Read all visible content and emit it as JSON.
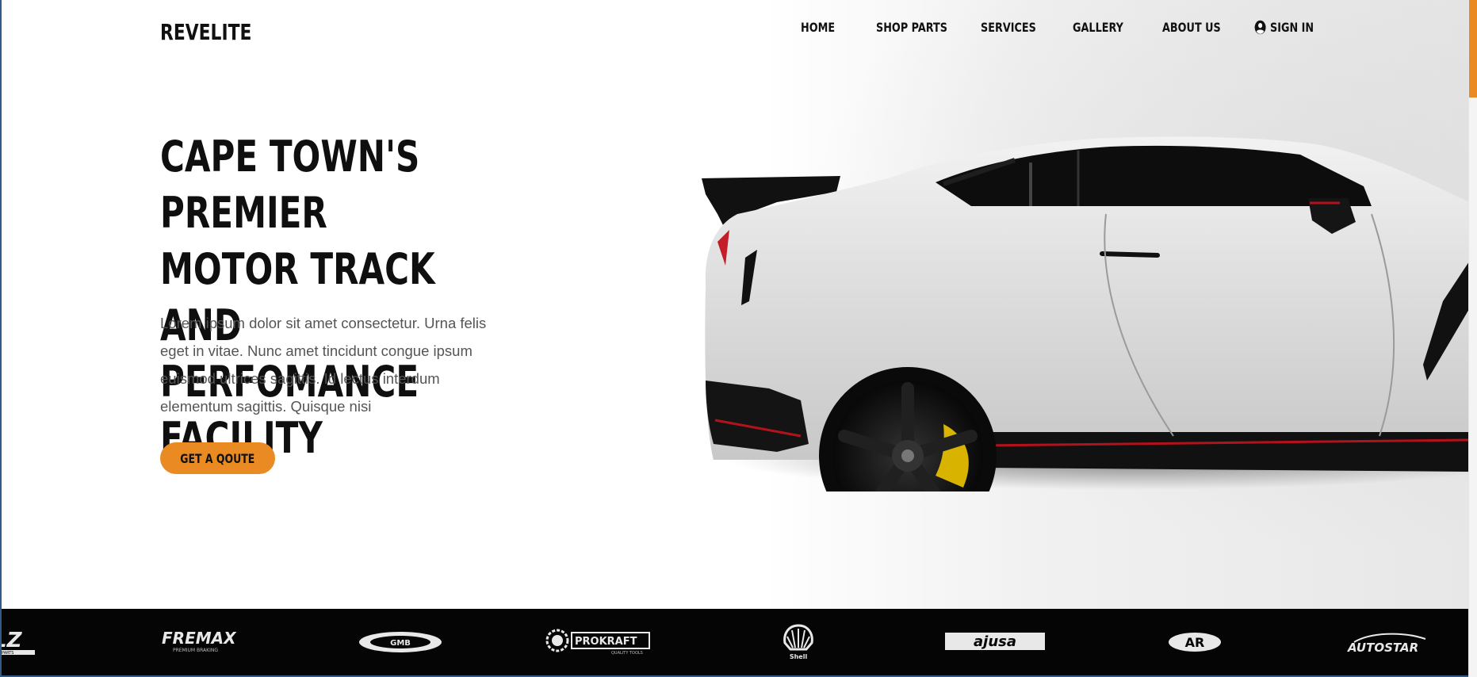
{
  "header": {
    "logo": "REVELITE",
    "nav": {
      "home": "HOME",
      "shop_parts": "SHOP PARTS",
      "services": "SERVICES",
      "gallery": "GALLERY",
      "about_us": "ABOUT US",
      "sign_in": "SIGN IN"
    },
    "sign_in_icon": "user-circle-icon"
  },
  "hero": {
    "headline_lines": [
      "CAPE TOWN'S PREMIER",
      "MOTOR TRACK AND",
      "PERFOMANCE FACILITY"
    ],
    "body": "Lorem ipsum dolor sit amet consectetur. Urna felis eget in vitae. Nunc amet tincidunt congue ipsum euismod ultrices sagittis. Id lectus interdum elementum sagittis. Quisque nisi",
    "cta": "GET A QOUTE",
    "image": "white-sports-car"
  },
  "brands": [
    {
      "name": "LZ",
      "subtext": "PARTS"
    },
    {
      "name": "FREMAX",
      "subtext": "PREMIUM BRAKING"
    },
    {
      "name": "GMB",
      "subtext": ""
    },
    {
      "name": "PROKRAFT",
      "subtext": "QUALITY TOOLS"
    },
    {
      "name": "Shell",
      "subtext": ""
    },
    {
      "name": "ajusa",
      "subtext": ""
    },
    {
      "name": "AR",
      "subtext": ""
    },
    {
      "name": "AUTOSTAR",
      "subtext": ""
    }
  ],
  "colors": {
    "accent": "#e98a22",
    "text": "#111111",
    "body_text": "#555555",
    "brand_bar": "#050505",
    "frame": "#2f5b86"
  }
}
